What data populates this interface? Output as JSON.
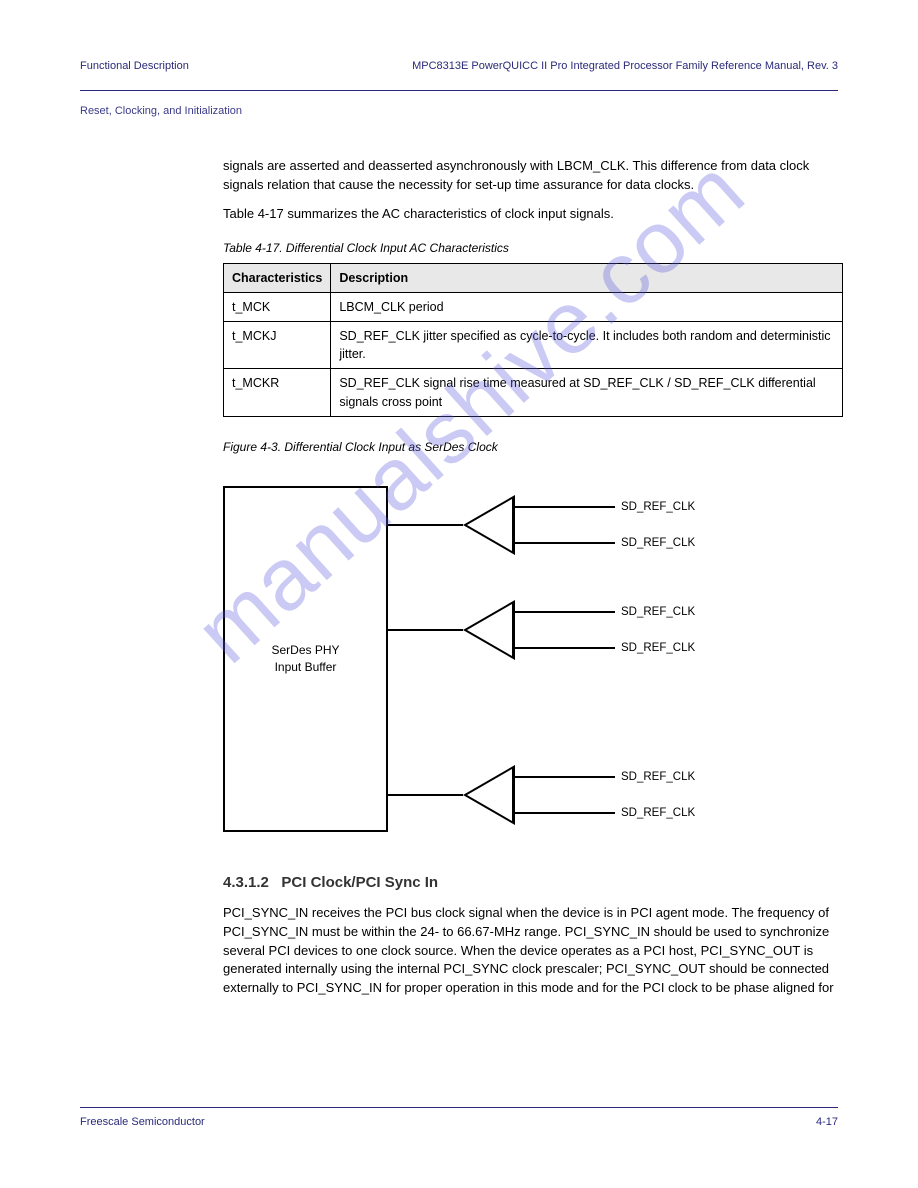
{
  "header": {
    "left": "Functional Description",
    "right": "MPC8313E PowerQUICC II Pro Integrated Processor Family Reference Manual, Rev. 3",
    "breadcrumb": "Reset, Clocking, and Initialization"
  },
  "body": {
    "p1": "signals are asserted and deasserted asynchronously with LBCM_CLK. This difference from data clock signals relation that cause the necessity for set-up time assurance for data clocks.",
    "p2": "Table 4-17 summarizes the AC characteristics of clock input signals."
  },
  "table": {
    "title": "Table 4-17. Differential Clock Input AC Characteristics",
    "headers": [
      "Characteristics",
      "Description"
    ],
    "rows": [
      [
        "t_MCK",
        "LBCM_CLK period"
      ],
      [
        "t_MCKJ",
        "SD_REF_CLK jitter specified as cycle-to-cycle. It includes both random and deterministic jitter."
      ],
      [
        "t_MCKR",
        "SD_REF_CLK signal rise time measured at SD_REF_CLK / SD_REF_CLK differential signals cross point"
      ]
    ]
  },
  "figure": {
    "title": "Figure 4-3. Differential Clock Input as SerDes Clock",
    "block_label": "SerDes PHY\nInput Buffer",
    "signals": [
      {
        "top": "SD_REF_CLK",
        "bottom": "SD_REF_CLK"
      },
      {
        "top": "SD_REF_CLK",
        "bottom": "SD_REF_CLK"
      },
      {
        "top": "SD_REF_CLK",
        "bottom": "SD_REF_CLK"
      }
    ]
  },
  "section": {
    "number": "4.3.1.2",
    "title": "PCI Clock/PCI Sync In",
    "p1": "PCI_SYNC_IN receives the PCI bus clock signal when the device is in PCI agent mode. The frequency of PCI_SYNC_IN must be within the 24- to 66.67-MHz range. PCI_SYNC_IN should be used to synchronize several PCI devices to one clock source. When the device operates as a PCI host, PCI_SYNC_OUT is generated internally using the internal PCI_SYNC clock prescaler; PCI_SYNC_OUT should be connected externally to PCI_SYNC_IN for proper operation in this mode and for the PCI clock to be phase aligned for"
  },
  "footer": {
    "left": "Freescale Semiconductor",
    "right": "4-17"
  },
  "watermark": "manualshive.com"
}
